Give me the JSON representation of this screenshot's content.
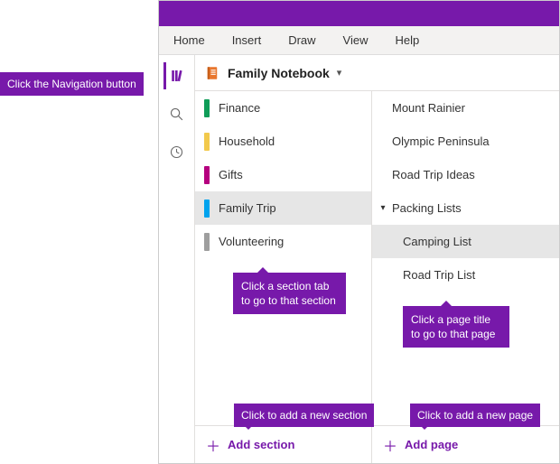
{
  "menu": {
    "items": [
      "Home",
      "Insert",
      "Draw",
      "View",
      "Help"
    ]
  },
  "notebook": {
    "title": "Family Notebook"
  },
  "sections": [
    {
      "label": "Finance",
      "color": "#0f9d58",
      "selected": false
    },
    {
      "label": "Household",
      "color": "#f2c94c",
      "selected": false
    },
    {
      "label": "Gifts",
      "color": "#b5007f",
      "selected": false
    },
    {
      "label": "Family Trip",
      "color": "#00a3ee",
      "selected": true
    },
    {
      "label": "Volunteering",
      "color": "#9e9e9e",
      "selected": false
    }
  ],
  "pages": [
    {
      "label": "Mount Rainier",
      "type": "page"
    },
    {
      "label": "Olympic Peninsula",
      "type": "page"
    },
    {
      "label": "Road Trip Ideas",
      "type": "page"
    },
    {
      "label": "Packing Lists",
      "type": "group"
    },
    {
      "label": "Camping List",
      "type": "sub",
      "selected": true
    },
    {
      "label": "Road Trip List",
      "type": "sub"
    }
  ],
  "actions": {
    "add_section": "Add section",
    "add_page": "Add page"
  },
  "callouts": {
    "nav": "Click the Navigation button",
    "section": "Click a section tab\nto go to that section",
    "page": "Click a page title\nto go to that page",
    "new_section": "Click to add a new section",
    "new_page": "Click to add a new page"
  },
  "colors": {
    "brand": "#7719aa"
  }
}
